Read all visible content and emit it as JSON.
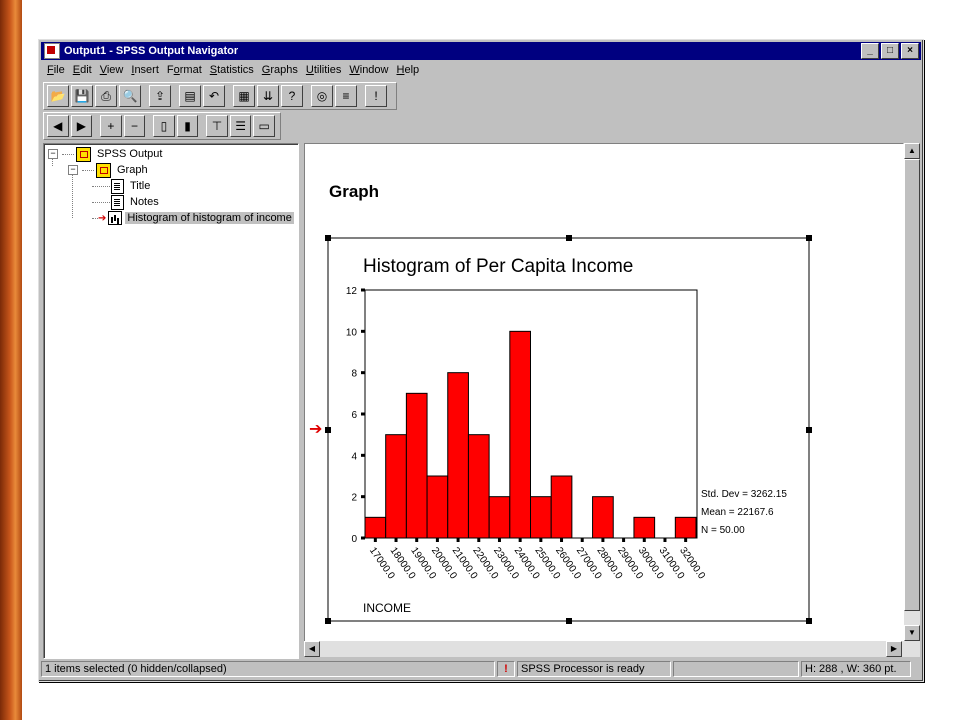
{
  "window": {
    "title": "Output1 - SPSS Output Navigator"
  },
  "titlebar_buttons": {
    "minimize": "_",
    "maximize": "□",
    "close": "×"
  },
  "menu": [
    {
      "pre": "",
      "u": "F",
      "post": "ile"
    },
    {
      "pre": "",
      "u": "E",
      "post": "dit"
    },
    {
      "pre": "",
      "u": "V",
      "post": "iew"
    },
    {
      "pre": "",
      "u": "I",
      "post": "nsert"
    },
    {
      "pre": "F",
      "u": "o",
      "post": "rmat"
    },
    {
      "pre": "",
      "u": "S",
      "post": "tatistics"
    },
    {
      "pre": "",
      "u": "G",
      "post": "raphs"
    },
    {
      "pre": "",
      "u": "U",
      "post": "tilities"
    },
    {
      "pre": "",
      "u": "W",
      "post": "indow"
    },
    {
      "pre": "",
      "u": "H",
      "post": "elp"
    }
  ],
  "toolbar1": [
    {
      "name": "open-icon",
      "glyph": "📂"
    },
    {
      "name": "save-icon",
      "glyph": "💾"
    },
    {
      "name": "print-icon",
      "glyph": "⎙"
    },
    {
      "name": "print-preview-icon",
      "glyph": "🔍"
    },
    {
      "sep": true
    },
    {
      "name": "export-icon",
      "glyph": "⇪"
    },
    {
      "sep": true
    },
    {
      "name": "dialog-recall-icon",
      "glyph": "▤"
    },
    {
      "name": "undo-icon",
      "glyph": "↶"
    },
    {
      "sep": true
    },
    {
      "name": "goto-data-icon",
      "glyph": "▦"
    },
    {
      "name": "goto-case-icon",
      "glyph": "⇊"
    },
    {
      "name": "variables-icon",
      "glyph": "?"
    },
    {
      "sep": true
    },
    {
      "name": "find-icon",
      "glyph": "◎"
    },
    {
      "name": "designate-window-icon",
      "glyph": "≡"
    },
    {
      "sep": true
    },
    {
      "name": "run-icon",
      "glyph": "!"
    }
  ],
  "toolbar2": [
    {
      "name": "promote-icon",
      "glyph": "◀"
    },
    {
      "name": "demote-icon",
      "glyph": "▶"
    },
    {
      "sep": true
    },
    {
      "name": "expand-icon",
      "glyph": "+"
    },
    {
      "name": "collapse-icon",
      "glyph": "−"
    },
    {
      "sep": true
    },
    {
      "name": "show-icon",
      "glyph": "▯"
    },
    {
      "name": "hide-icon",
      "glyph": "▮"
    },
    {
      "sep": true
    },
    {
      "name": "insert-heading-icon",
      "glyph": "⊤"
    },
    {
      "name": "insert-title-icon",
      "glyph": "☰"
    },
    {
      "name": "insert-text-icon",
      "glyph": "▭"
    }
  ],
  "tree": {
    "root": "SPSS Output",
    "group": "Graph",
    "items": [
      "Title",
      "Notes",
      "Histogram of histogram of income"
    ]
  },
  "content": {
    "heading": "Graph"
  },
  "chart_data": {
    "type": "bar",
    "title": "Histogram of Per Capita Income",
    "xlabel": "INCOME",
    "ylabel": "",
    "ylim": [
      0,
      12
    ],
    "yticks": [
      0,
      2,
      4,
      6,
      8,
      10,
      12
    ],
    "categories": [
      "17000.0",
      "18000.0",
      "19000.0",
      "20000.0",
      "21000.0",
      "22000.0",
      "23000.0",
      "24000.0",
      "25000.0",
      "26000.0",
      "27000.0",
      "28000.0",
      "29000.0",
      "30000.0",
      "31000.0",
      "32000.0"
    ],
    "values": [
      1,
      5,
      7,
      3,
      8,
      5,
      2,
      10,
      2,
      3,
      0,
      2,
      0,
      1,
      0,
      1
    ],
    "stats": [
      "Std. Dev = 3262.15",
      "Mean = 22167.6",
      "N = 50.00"
    ],
    "bar_color": "#ff0000",
    "grid": false
  },
  "status": {
    "selection": "1 items selected (0 hidden/collapsed)",
    "processor": "SPSS Processor is ready",
    "size": "H: 288 , W: 360  pt."
  }
}
